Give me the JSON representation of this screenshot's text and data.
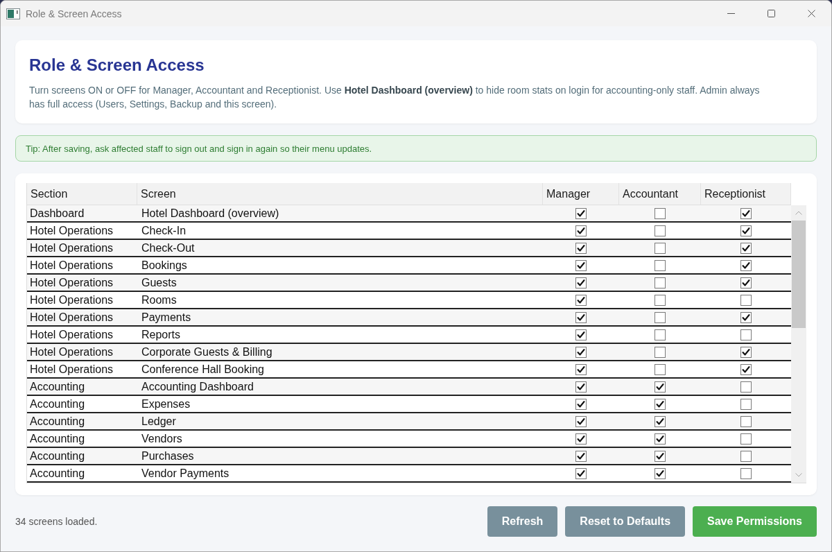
{
  "window": {
    "title": "Role & Screen Access"
  },
  "header": {
    "title": "Role & Screen Access",
    "description": "Turn screens ON or OFF for Manager, Accountant and Receptionist. Use **Hotel Dashboard (overview)** to hide room stats on login for accounting-only staff. Admin always has full access (Users, Settings, Backup and this screen)."
  },
  "tip": "Tip: After saving, ask affected staff to sign out and sign in again so their menu updates.",
  "table": {
    "columns": [
      "Section",
      "Screen",
      "Manager",
      "Accountant",
      "Receptionist"
    ],
    "rows": [
      {
        "section": "Dashboard",
        "screen": "Hotel Dashboard (overview)",
        "checked": [
          true,
          false,
          true
        ]
      },
      {
        "section": "Hotel Operations",
        "screen": "Check-In",
        "checked": [
          true,
          false,
          true
        ]
      },
      {
        "section": "Hotel Operations",
        "screen": "Check-Out",
        "checked": [
          true,
          false,
          true
        ]
      },
      {
        "section": "Hotel Operations",
        "screen": "Bookings",
        "checked": [
          true,
          false,
          true
        ]
      },
      {
        "section": "Hotel Operations",
        "screen": "Guests",
        "checked": [
          true,
          false,
          true
        ]
      },
      {
        "section": "Hotel Operations",
        "screen": "Rooms",
        "checked": [
          true,
          false,
          false
        ]
      },
      {
        "section": "Hotel Operations",
        "screen": "Payments",
        "checked": [
          true,
          false,
          true
        ]
      },
      {
        "section": "Hotel Operations",
        "screen": "Reports",
        "checked": [
          true,
          false,
          false
        ]
      },
      {
        "section": "Hotel Operations",
        "screen": "Corporate Guests & Billing",
        "checked": [
          true,
          false,
          true
        ]
      },
      {
        "section": "Hotel Operations",
        "screen": "Conference Hall Booking",
        "checked": [
          true,
          false,
          true
        ]
      },
      {
        "section": "Accounting",
        "screen": "Accounting Dashboard",
        "checked": [
          true,
          true,
          false
        ]
      },
      {
        "section": "Accounting",
        "screen": "Expenses",
        "checked": [
          true,
          true,
          false
        ]
      },
      {
        "section": "Accounting",
        "screen": "Ledger",
        "checked": [
          true,
          true,
          false
        ]
      },
      {
        "section": "Accounting",
        "screen": "Vendors",
        "checked": [
          true,
          true,
          false
        ]
      },
      {
        "section": "Accounting",
        "screen": "Purchases",
        "checked": [
          true,
          true,
          false
        ]
      },
      {
        "section": "Accounting",
        "screen": "Vendor Payments",
        "checked": [
          true,
          true,
          false
        ]
      }
    ]
  },
  "status_bar": "34 screens loaded.",
  "buttons": [
    {
      "label": "Refresh",
      "kind": "secondary"
    },
    {
      "label": "Reset to Defaults",
      "kind": "secondary"
    },
    {
      "label": "Save Permissions",
      "kind": "primary"
    }
  ]
}
